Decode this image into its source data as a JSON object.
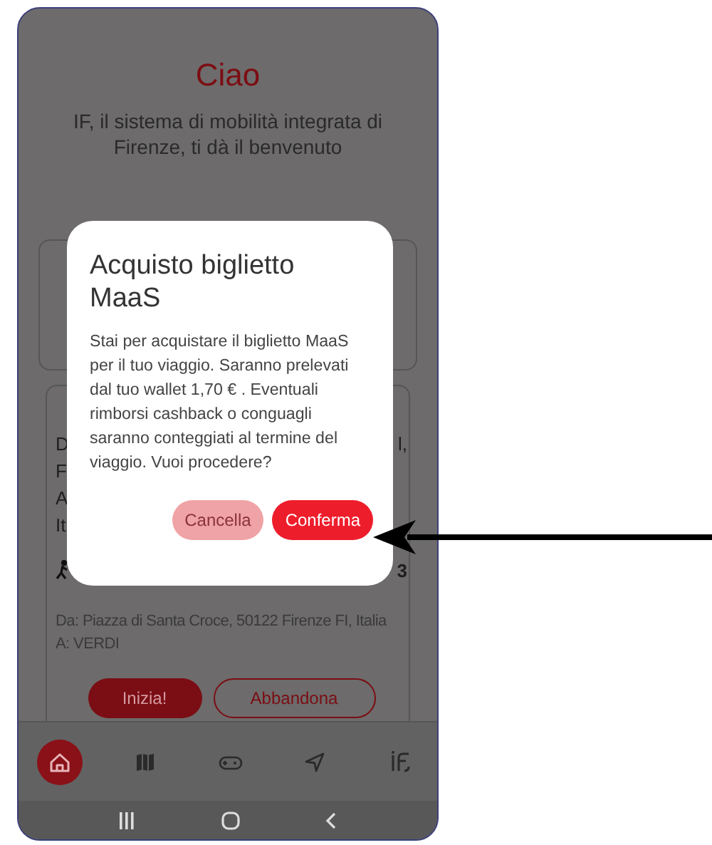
{
  "screen": {
    "greeting": "Ciao",
    "welcome": "IF, il sistema di mobilità integrata di Firenze, ti dà il benvenuto",
    "trip_card": {
      "obscured_left": [
        "D",
        "F",
        "A",
        "It"
      ],
      "obscured_right": [
        "l,"
      ],
      "duration_fragment": "3",
      "from": "Da: Piazza di Santa Croce, 50122 Firenze FI, Italia",
      "to": "A: VERDI",
      "buttons": [
        {
          "label": "Inizia!",
          "kind": "primary"
        },
        {
          "label": "Abbandona",
          "kind": "outline"
        }
      ]
    }
  },
  "dialog": {
    "title": "Acquisto biglietto MaaS",
    "message": "Stai per acquistare il biglietto MaaS per il tuo viaggio. Saranno prelevati dal tuo wallet  1,70 € . Eventuali rimborsi cashback o conguagli saranno conteggiati al termine del viaggio. Vuoi procedere?",
    "buttons": [
      {
        "label": "Cancella",
        "kind": "secondary"
      },
      {
        "label": "Conferma",
        "kind": "primary"
      }
    ]
  },
  "tab_bar": {
    "items": [
      {
        "kind": "home",
        "selected": true
      },
      {
        "kind": "map",
        "selected": false
      },
      {
        "kind": "gamepad",
        "selected": false
      },
      {
        "kind": "navigate",
        "selected": false
      },
      {
        "kind": "logo",
        "selected": false
      }
    ]
  }
}
